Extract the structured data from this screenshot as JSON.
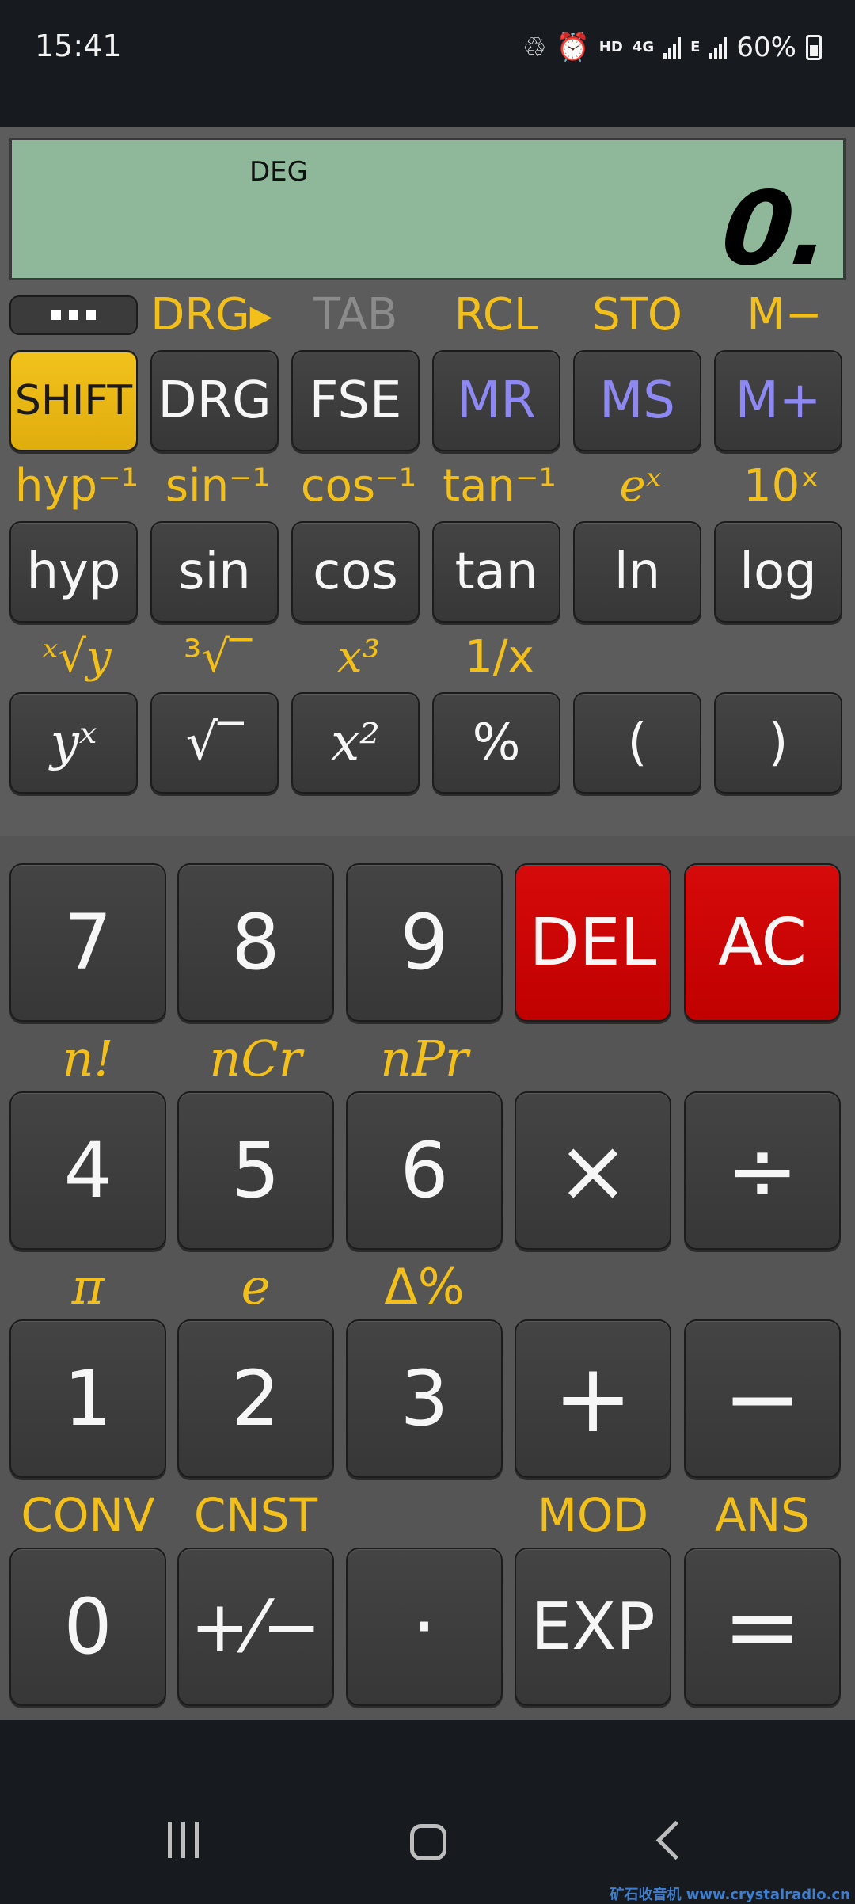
{
  "status": {
    "time": "15:41",
    "hd": "HD",
    "net": "4G",
    "e": "E",
    "battery": "60%"
  },
  "display": {
    "mode": "DEG",
    "value": "0."
  },
  "sci_rows": [
    {
      "labels": [
        "DRG▸",
        "TAB",
        "RCL",
        "STO",
        "M−"
      ],
      "keys": [
        "SHIFT",
        "DRG",
        "FSE",
        "MR",
        "MS",
        "M+"
      ]
    },
    {
      "labels": [
        "hyp⁻¹",
        "sin⁻¹",
        "cos⁻¹",
        "tan⁻¹",
        "eˣ",
        "10ˣ"
      ],
      "keys": [
        "hyp",
        "sin",
        "cos",
        "tan",
        "ln",
        "log"
      ]
    },
    {
      "labels": [
        "ˣ√y",
        "³√‾",
        "x³",
        "1/x"
      ],
      "keys": [
        "yˣ",
        "√‾",
        "x²",
        "%",
        "(",
        ")"
      ]
    }
  ],
  "num_rows": [
    {
      "labels": [],
      "keys": [
        "7",
        "8",
        "9",
        "DEL",
        "AC"
      ]
    },
    {
      "labels": [
        "n!",
        "nCr",
        "nPr"
      ],
      "keys": [
        "4",
        "5",
        "6",
        "×",
        "÷"
      ]
    },
    {
      "labels": [
        "π",
        "e",
        "Δ%"
      ],
      "keys": [
        "1",
        "2",
        "3",
        "+",
        "−"
      ]
    },
    {
      "labels": [
        "CONV",
        "CNST",
        "",
        "MOD",
        "ANS"
      ],
      "keys": [
        "0",
        "+⁄−",
        "·",
        "EXP",
        "="
      ]
    }
  ],
  "watermark": "矿石收音机 www.crystalradio.cn"
}
